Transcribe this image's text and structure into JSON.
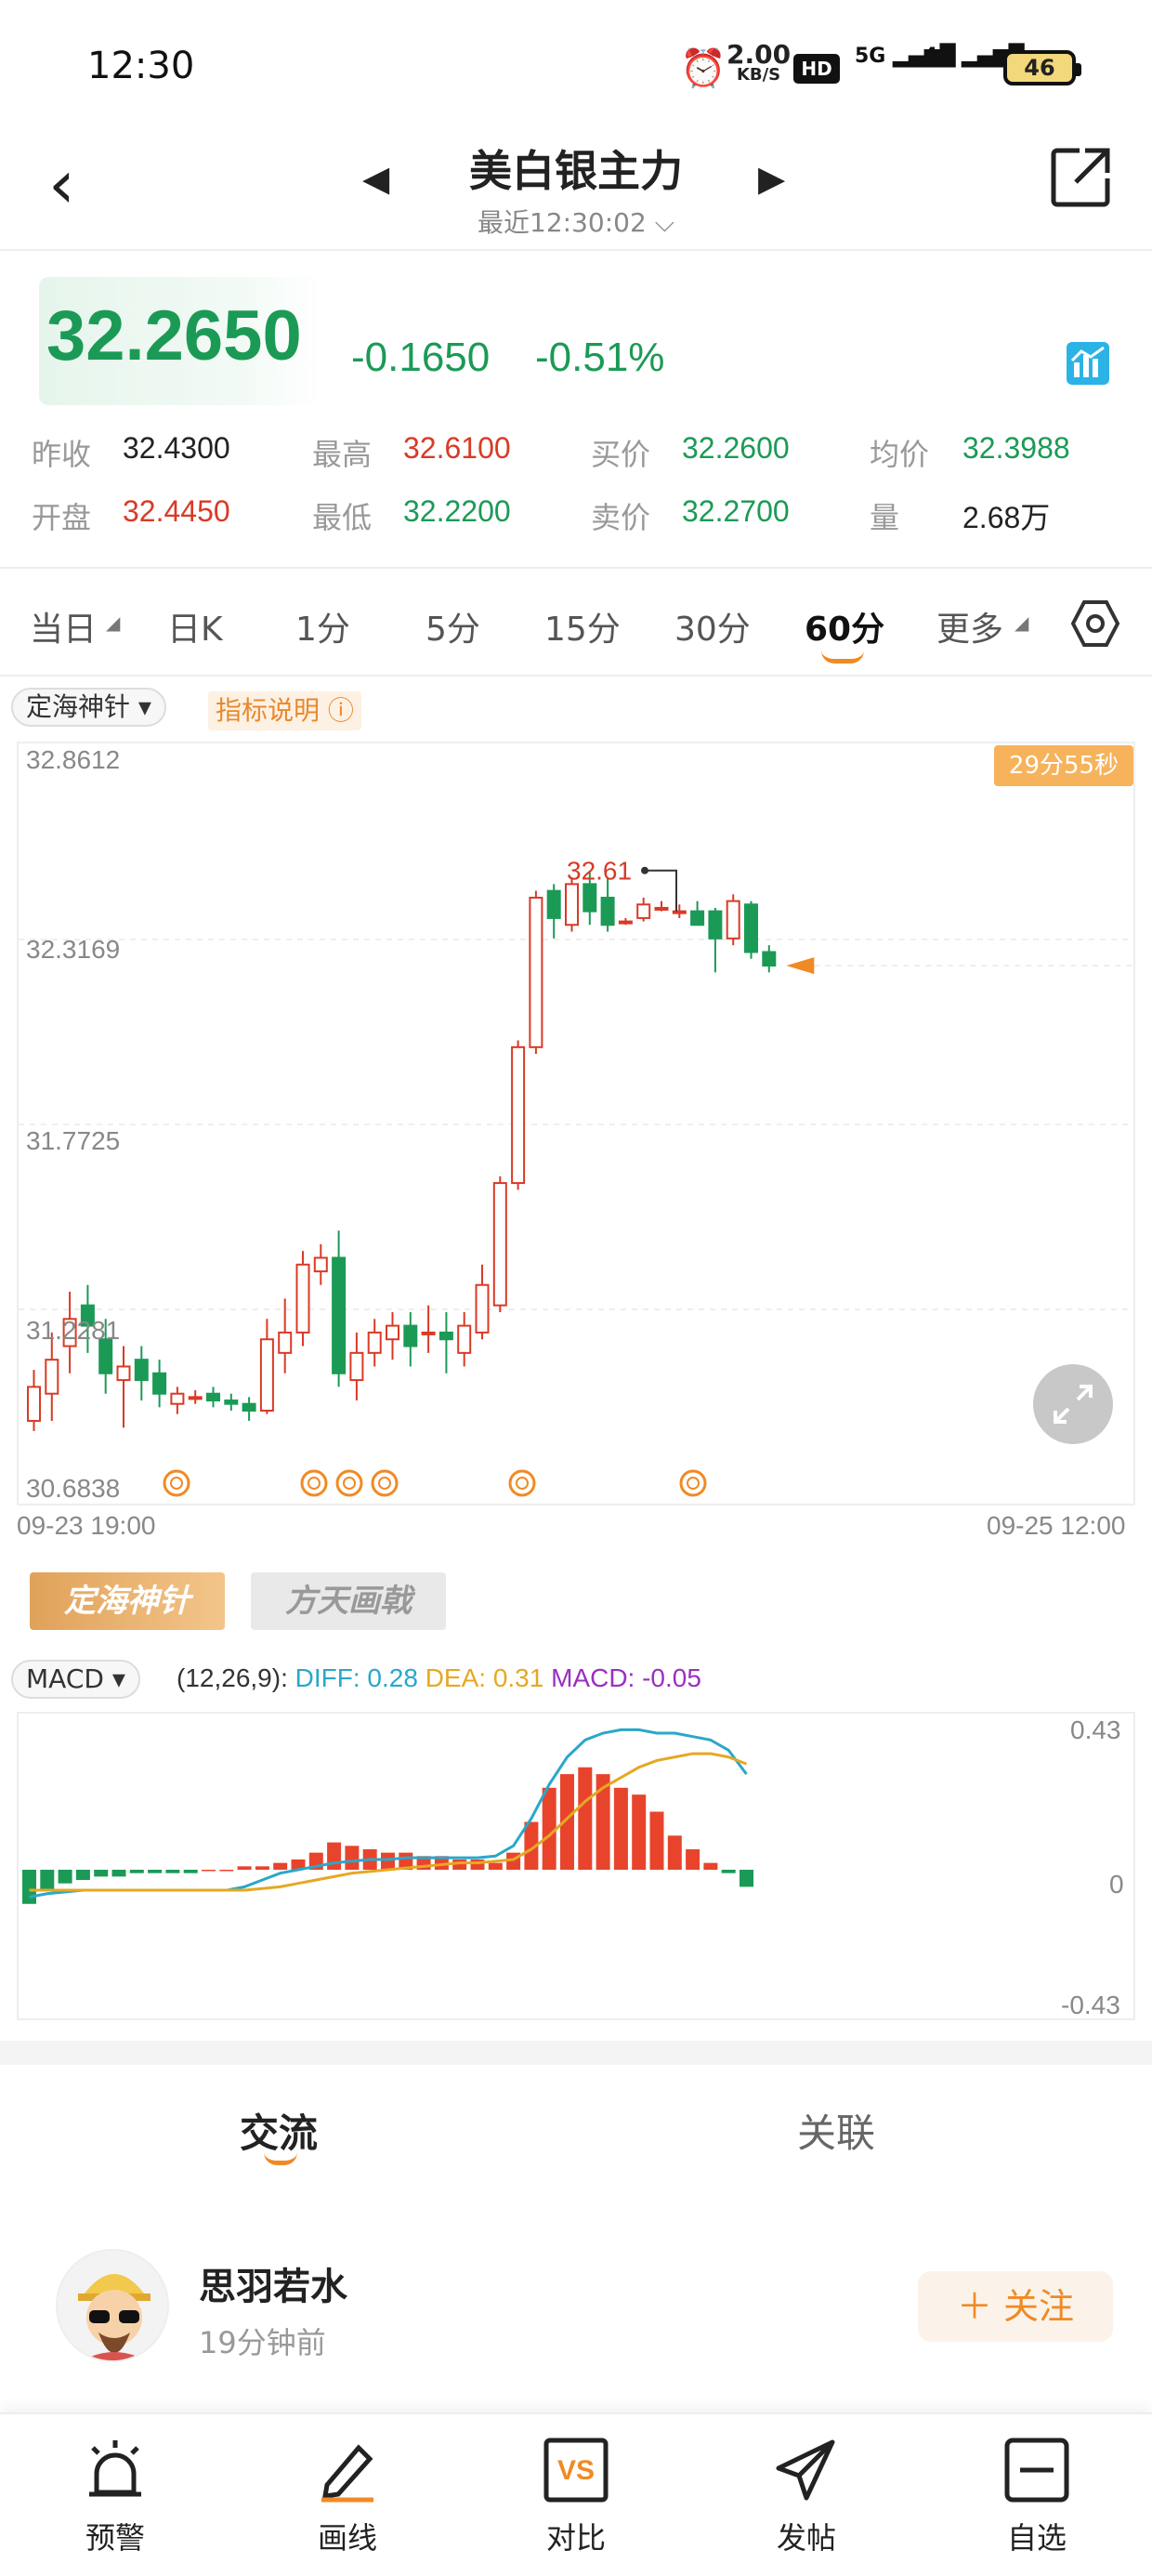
{
  "status_bar": {
    "time": "12:30",
    "net_speed": "2.00",
    "net_unit": "KB/S",
    "hd": "HD",
    "sig1": "5G",
    "sig2": "4G",
    "battery": "46"
  },
  "header": {
    "title": "美白银主力",
    "subtitle": "最近12:30:02 ⌵"
  },
  "quote": {
    "price": "32.2650",
    "change": "-0.1650",
    "change_pct": "-0.51%",
    "fields": [
      {
        "label": "昨收",
        "value": "32.4300",
        "tone": "dark"
      },
      {
        "label": "最高",
        "value": "32.6100",
        "tone": "red"
      },
      {
        "label": "买价",
        "value": "32.2600",
        "tone": "green"
      },
      {
        "label": "均价",
        "value": "32.3988",
        "tone": "green"
      },
      {
        "label": "开盘",
        "value": "32.4450",
        "tone": "red"
      },
      {
        "label": "最低",
        "value": "32.2200",
        "tone": "green"
      },
      {
        "label": "卖价",
        "value": "32.2700",
        "tone": "green"
      },
      {
        "label": "量",
        "value": "2.68万",
        "tone": "dark"
      }
    ]
  },
  "period_tabs": [
    "当日",
    "日K",
    "1分",
    "5分",
    "15分",
    "30分",
    "60分",
    "更多"
  ],
  "active_period": "60分",
  "indicator": {
    "name": "定海神针",
    "help": "指标说明 ⓘ",
    "timer": "29分55秒"
  },
  "colors": {
    "up": "#d93a26",
    "down": "#1b9a56",
    "accent": "#f08a24"
  },
  "kline_chart": {
    "y_labels": [
      "32.8612",
      "32.3169",
      "31.7725",
      "31.2281",
      "30.6838"
    ],
    "x_labels": [
      "09-23 19:00",
      "09-25 12:00"
    ],
    "high_label": "32.61"
  },
  "signal_buttons": [
    "定海神针",
    "方天画戟"
  ],
  "macd": {
    "name": "MACD",
    "params": "(12,26,9):",
    "diff": "DIFF: 0.28",
    "dea": "DEA: 0.31",
    "macd": "MACD: -0.05",
    "y_labels": [
      "0.43",
      "0",
      "-0.43"
    ]
  },
  "chart_data": [
    {
      "type": "candlestick",
      "title": "",
      "ylim": [
        30.6838,
        32.8612
      ],
      "candles": [
        {
          "o": 30.9,
          "c": 31.0,
          "h": 31.05,
          "l": 30.87
        },
        {
          "o": 30.98,
          "c": 31.08,
          "h": 31.16,
          "l": 30.9
        },
        {
          "o": 31.12,
          "c": 31.2,
          "h": 31.28,
          "l": 31.04
        },
        {
          "o": 31.24,
          "c": 31.18,
          "h": 31.3,
          "l": 31.1
        },
        {
          "o": 31.14,
          "c": 31.04,
          "h": 31.2,
          "l": 30.98
        },
        {
          "o": 31.02,
          "c": 31.06,
          "h": 31.12,
          "l": 30.88
        },
        {
          "o": 31.08,
          "c": 31.02,
          "h": 31.12,
          "l": 30.96
        },
        {
          "o": 31.04,
          "c": 30.98,
          "h": 31.08,
          "l": 30.94
        },
        {
          "o": 30.95,
          "c": 30.98,
          "h": 31.0,
          "l": 30.92
        },
        {
          "o": 30.97,
          "c": 30.97,
          "h": 30.99,
          "l": 30.95
        },
        {
          "o": 30.98,
          "c": 30.96,
          "h": 31.0,
          "l": 30.94
        },
        {
          "o": 30.96,
          "c": 30.95,
          "h": 30.98,
          "l": 30.93
        },
        {
          "o": 30.95,
          "c": 30.93,
          "h": 30.97,
          "l": 30.9
        },
        {
          "o": 30.93,
          "c": 31.14,
          "h": 31.2,
          "l": 30.92
        },
        {
          "o": 31.1,
          "c": 31.16,
          "h": 31.26,
          "l": 31.04
        },
        {
          "o": 31.16,
          "c": 31.36,
          "h": 31.4,
          "l": 31.12
        },
        {
          "o": 31.34,
          "c": 31.38,
          "h": 31.42,
          "l": 31.3
        },
        {
          "o": 31.38,
          "c": 31.04,
          "h": 31.46,
          "l": 31.0
        },
        {
          "o": 31.02,
          "c": 31.1,
          "h": 31.16,
          "l": 30.96
        },
        {
          "o": 31.1,
          "c": 31.16,
          "h": 31.2,
          "l": 31.06
        },
        {
          "o": 31.14,
          "c": 31.18,
          "h": 31.22,
          "l": 31.08
        },
        {
          "o": 31.18,
          "c": 31.12,
          "h": 31.22,
          "l": 31.06
        },
        {
          "o": 31.16,
          "c": 31.16,
          "h": 31.24,
          "l": 31.1
        },
        {
          "o": 31.16,
          "c": 31.14,
          "h": 31.22,
          "l": 31.04
        },
        {
          "o": 31.1,
          "c": 31.18,
          "h": 31.22,
          "l": 31.06
        },
        {
          "o": 31.16,
          "c": 31.3,
          "h": 31.36,
          "l": 31.14
        },
        {
          "o": 31.24,
          "c": 31.6,
          "h": 31.62,
          "l": 31.22
        },
        {
          "o": 31.6,
          "c": 32.0,
          "h": 32.02,
          "l": 31.58
        },
        {
          "o": 32.0,
          "c": 32.44,
          "h": 32.46,
          "l": 31.98
        },
        {
          "o": 32.46,
          "c": 32.38,
          "h": 32.48,
          "l": 32.32
        },
        {
          "o": 32.36,
          "c": 32.48,
          "h": 32.5,
          "l": 32.34
        },
        {
          "o": 32.48,
          "c": 32.4,
          "h": 32.52,
          "l": 32.36
        },
        {
          "o": 32.44,
          "c": 32.36,
          "h": 32.5,
          "l": 32.34
        },
        {
          "o": 32.37,
          "c": 32.37,
          "h": 32.38,
          "l": 32.36
        },
        {
          "o": 32.38,
          "c": 32.42,
          "h": 32.44,
          "l": 32.37
        },
        {
          "o": 32.41,
          "c": 32.41,
          "h": 32.43,
          "l": 32.4
        },
        {
          "o": 32.4,
          "c": 32.4,
          "h": 32.42,
          "l": 32.38
        },
        {
          "o": 32.4,
          "c": 32.36,
          "h": 32.43,
          "l": 32.36
        },
        {
          "o": 32.4,
          "c": 32.32,
          "h": 32.41,
          "l": 32.22
        },
        {
          "o": 32.32,
          "c": 32.43,
          "h": 32.45,
          "l": 32.3
        },
        {
          "o": 32.42,
          "c": 32.28,
          "h": 32.43,
          "l": 32.26
        },
        {
          "o": 32.28,
          "c": 32.24,
          "h": 32.3,
          "l": 32.22
        }
      ]
    },
    {
      "type": "bar",
      "title": "MACD",
      "ylim": [
        -0.43,
        0.43
      ],
      "series": [
        {
          "name": "MACD",
          "values": [
            -0.1,
            -0.06,
            -0.04,
            -0.03,
            -0.02,
            -0.02,
            -0.01,
            -0.01,
            -0.01,
            -0.01,
            0.0,
            0.0,
            0.01,
            0.01,
            0.02,
            0.03,
            0.05,
            0.08,
            0.07,
            0.06,
            0.05,
            0.05,
            0.04,
            0.04,
            0.03,
            0.03,
            0.02,
            0.05,
            0.14,
            0.24,
            0.28,
            0.3,
            0.28,
            0.24,
            0.22,
            0.17,
            0.1,
            0.06,
            0.02,
            -0.01,
            -0.05
          ]
        },
        {
          "name": "DIFF",
          "values": [
            -0.08,
            -0.07,
            -0.065,
            -0.06,
            -0.06,
            -0.06,
            -0.06,
            -0.06,
            -0.06,
            -0.06,
            -0.06,
            -0.06,
            -0.05,
            -0.03,
            -0.01,
            0.0,
            0.01,
            0.02,
            0.025,
            0.03,
            0.03,
            0.035,
            0.035,
            0.035,
            0.035,
            0.035,
            0.04,
            0.07,
            0.15,
            0.25,
            0.33,
            0.38,
            0.4,
            0.41,
            0.41,
            0.4,
            0.4,
            0.39,
            0.38,
            0.35,
            0.28
          ]
        },
        {
          "name": "DEA",
          "values": [
            -0.06,
            -0.06,
            -0.06,
            -0.06,
            -0.06,
            -0.06,
            -0.06,
            -0.06,
            -0.06,
            -0.06,
            -0.06,
            -0.06,
            -0.06,
            -0.055,
            -0.05,
            -0.04,
            -0.03,
            -0.02,
            -0.01,
            -0.005,
            0.0,
            0.005,
            0.01,
            0.015,
            0.02,
            0.02,
            0.025,
            0.03,
            0.06,
            0.1,
            0.15,
            0.2,
            0.24,
            0.27,
            0.3,
            0.32,
            0.33,
            0.34,
            0.34,
            0.33,
            0.31
          ]
        }
      ]
    }
  ],
  "bottom_tabs": [
    "交流",
    "关联"
  ],
  "post": {
    "user": "思羽若水",
    "time": "19分钟前",
    "follow": "＋ 关注"
  },
  "nav": [
    {
      "label": "预警",
      "icon": "alarm-icon"
    },
    {
      "label": "画线",
      "icon": "pencil-icon"
    },
    {
      "label": "对比",
      "icon": "vs-icon"
    },
    {
      "label": "发帖",
      "icon": "send-icon"
    },
    {
      "label": "自选",
      "icon": "minus-box-icon"
    }
  ]
}
